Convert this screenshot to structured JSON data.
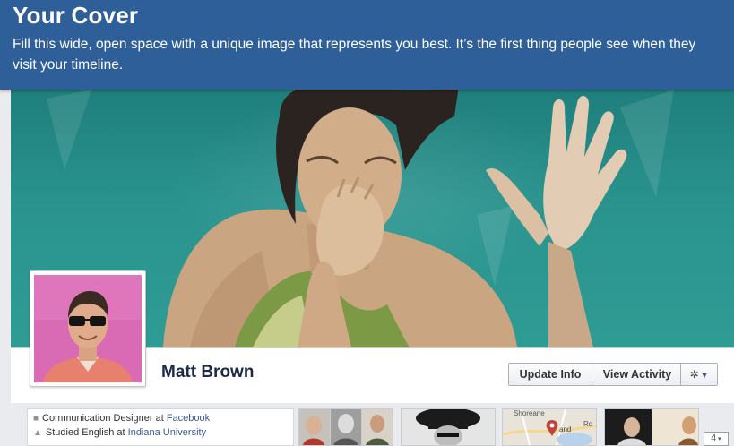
{
  "banner": {
    "title": "Your Cover",
    "text": "Fill this wide, open space with a unique image that represents you best. It’s the first thing people see when they visit your timeline."
  },
  "profile": {
    "name": "Matt Brown",
    "update_info_label": "Update Info",
    "view_activity_label": "View Activity",
    "settings_icon": "gear-icon"
  },
  "about": {
    "work_prefix": "Communication Designer at ",
    "work_link": "Facebook",
    "education_prefix": "Studied English at ",
    "education_link": "Indiana University"
  },
  "map": {
    "label_top": "Shoreane",
    "label_mid": "Rd",
    "label_place": "and"
  },
  "pager": {
    "value": "4"
  },
  "colors": {
    "banner": "#2f5f99",
    "link": "#3b5998",
    "name": "#1c2a47",
    "avatar_bg": "#d96ab4"
  }
}
